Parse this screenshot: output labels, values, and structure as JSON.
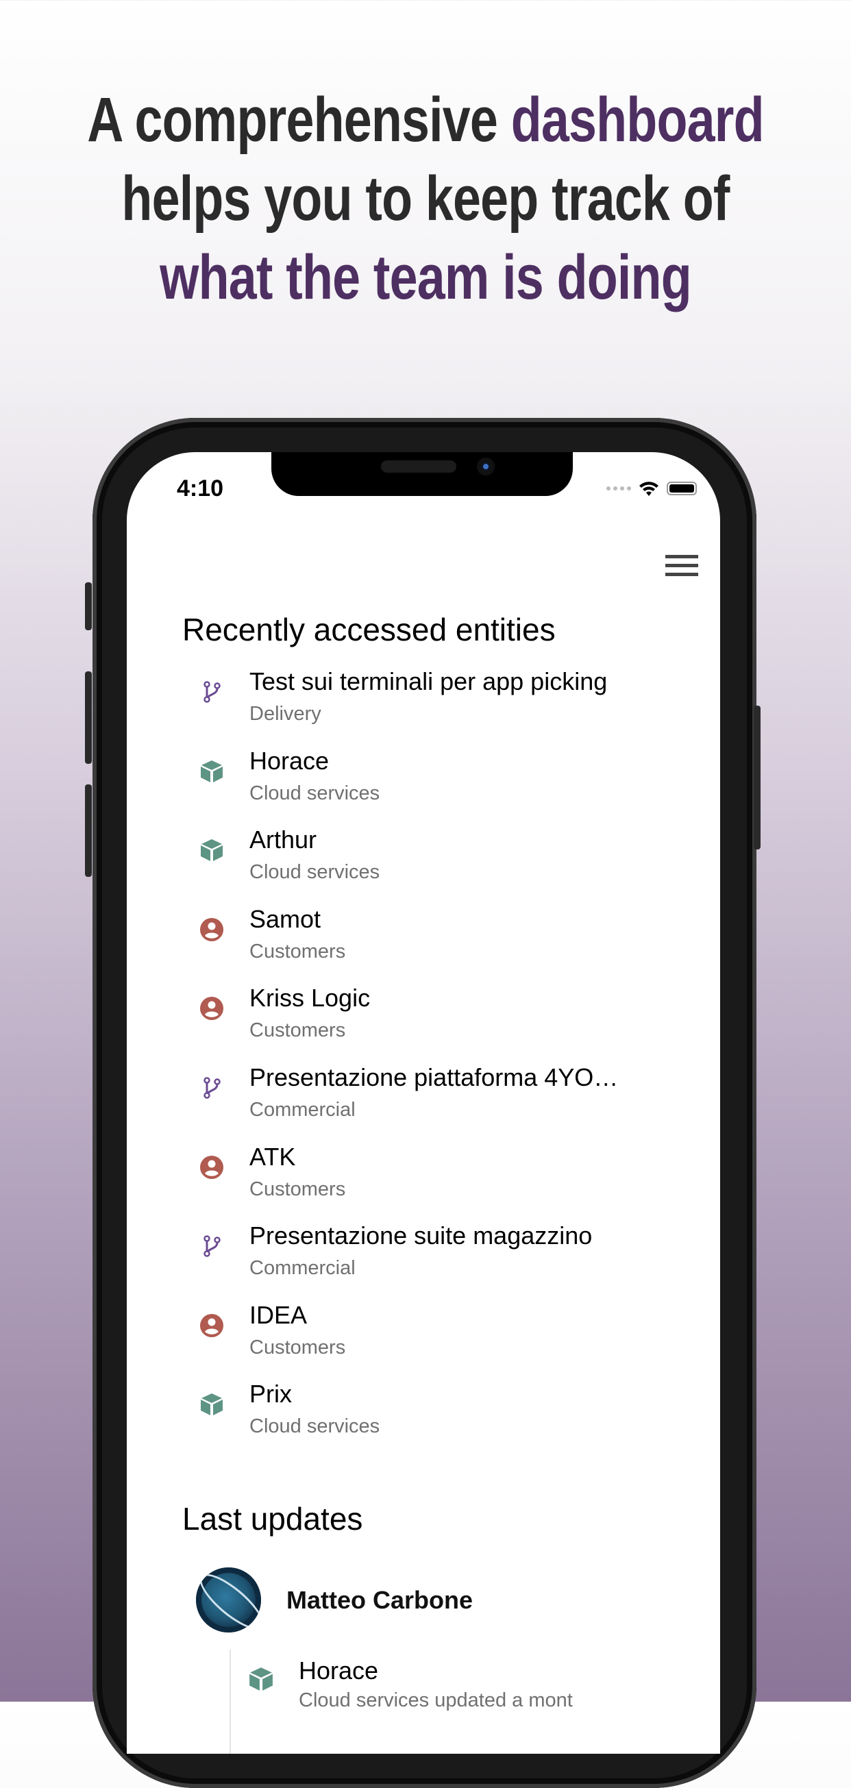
{
  "headline": {
    "line1_a": "A comprehensive ",
    "line1_b": "dashboard",
    "line2": "helps you to keep track of",
    "line3": "what the team is doing"
  },
  "colors": {
    "accent": "#4e2f62",
    "branch": "#6b4a92",
    "cube": "#5e9484",
    "person": "#b05a50"
  },
  "status_bar": {
    "time": "4:10",
    "icons": [
      "signal-icon",
      "wifi-icon",
      "battery-icon"
    ]
  },
  "header": {
    "menu_icon": "hamburger-menu-icon"
  },
  "recent": {
    "title": "Recently accessed entities",
    "items": [
      {
        "title": "Test sui terminali per app picking",
        "subtitle": "Delivery",
        "icon": "branch"
      },
      {
        "title": "Horace",
        "subtitle": "Cloud services",
        "icon": "cube"
      },
      {
        "title": "Arthur",
        "subtitle": "Cloud services",
        "icon": "cube"
      },
      {
        "title": "Samot",
        "subtitle": "Customers",
        "icon": "person"
      },
      {
        "title": "Kriss Logic",
        "subtitle": "Customers",
        "icon": "person"
      },
      {
        "title": "Presentazione piattaforma 4YO…",
        "subtitle": "Commercial",
        "icon": "branch"
      },
      {
        "title": "ATK",
        "subtitle": "Customers",
        "icon": "person"
      },
      {
        "title": "Presentazione suite magazzino",
        "subtitle": "Commercial",
        "icon": "branch"
      },
      {
        "title": "IDEA",
        "subtitle": "Customers",
        "icon": "person"
      },
      {
        "title": "Prix",
        "subtitle": "Cloud services",
        "icon": "cube"
      }
    ]
  },
  "updates": {
    "title": "Last updates",
    "user": "Matteo Carbone",
    "entries": [
      {
        "title": "Horace",
        "subtitle": "Cloud services updated a mont",
        "icon": "cube"
      }
    ]
  }
}
